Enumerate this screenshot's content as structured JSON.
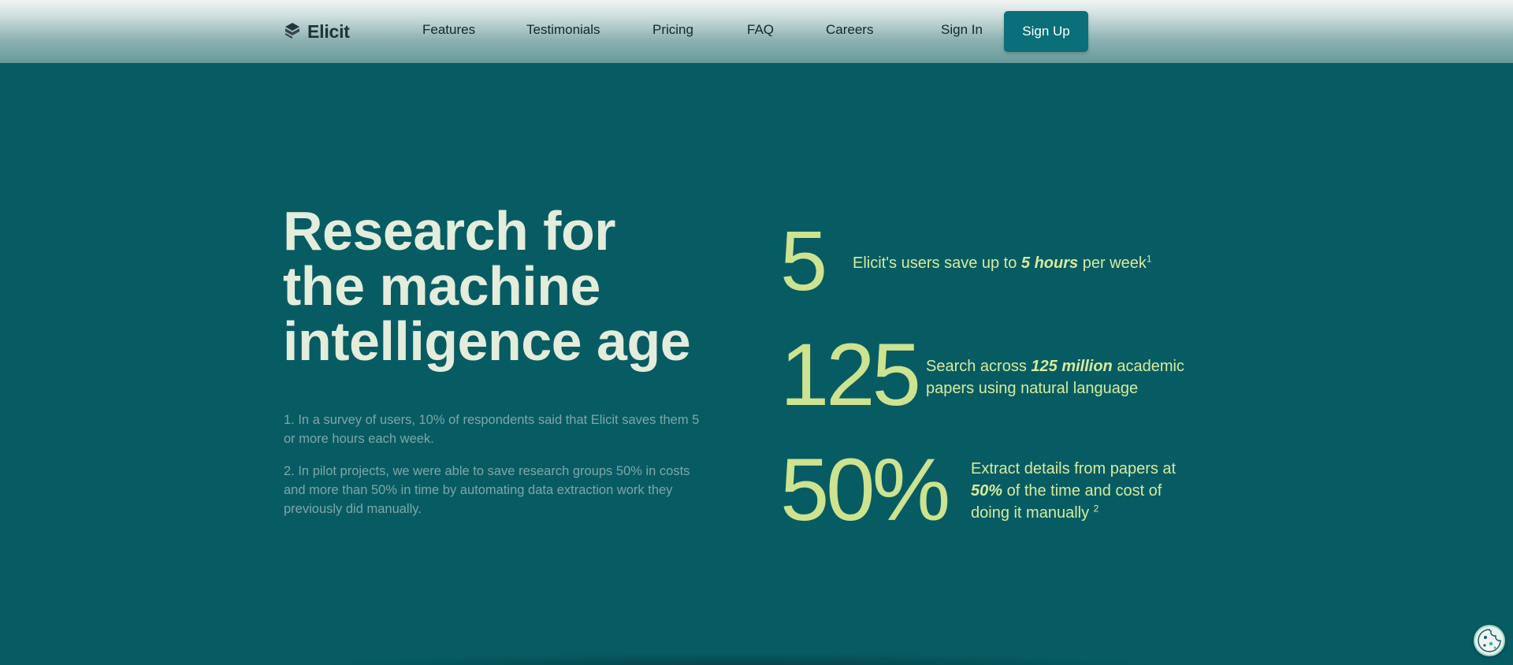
{
  "nav": {
    "logo_text": "Elicit",
    "logo_icon": "stacked-layers-icon",
    "links": [
      "Features",
      "Testimonials",
      "Pricing",
      "FAQ",
      "Careers"
    ],
    "sign_in": "Sign In",
    "sign_up": "Sign Up"
  },
  "hero": {
    "title_lines": [
      "Research for",
      "the machine",
      "intelligence age"
    ],
    "footnotes": [
      "1. In a survey of users, 10% of respondents said that Elicit saves them 5 or more hours each week.",
      "2. In pilot projects, we were able to save research groups 50% in costs and more than 50% in time by automating data extraction work they previously did manually."
    ]
  },
  "stats": [
    {
      "number": "5",
      "text_before": "Elicit's users save up to ",
      "highlight": "5 hours",
      "text_after": " per week",
      "sup": "1"
    },
    {
      "number": "125",
      "text_before": "Search across ",
      "highlight": "125 million",
      "text_after": " academic papers using natural language",
      "sup": ""
    },
    {
      "number": "50%",
      "text_before": "Extract details from papers at ",
      "highlight": "50%",
      "text_after": " of the time and cost of doing it manually ",
      "sup": "2"
    }
  ],
  "cookie_icon": "cookie-icon",
  "colors": {
    "background": "#075c63",
    "accent_button": "#0a6f78",
    "stat_number": "#cde38f",
    "stat_text": "#d7ea9e",
    "title": "#e4ecdc",
    "footnote": "#7ea6a6"
  }
}
